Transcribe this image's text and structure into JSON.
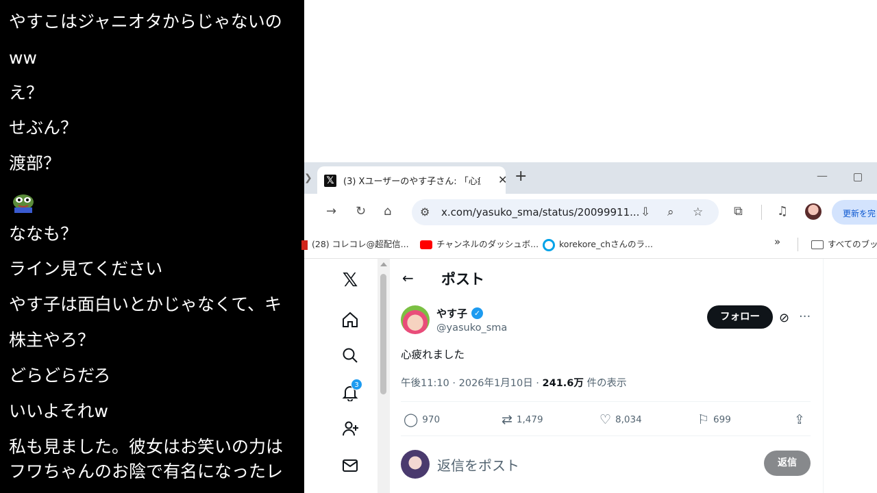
{
  "comments": [
    "やすこはジャニオタからじゃないの",
    "ww",
    "え？",
    "せぶん？",
    "渡部？",
    "ななも？",
    "ライン見てください",
    "やす子は面白いとかじゃなくて、キ",
    "株主やろ？",
    "どらどらだろ",
    "いいよそれw",
    "私も見ました。彼女はお笑いの力は",
    "フワちゃんのお陰で有名になったレ"
  ],
  "browser": {
    "tab_title": "(3) Xユーザーのやす子さん: 「心疲れ",
    "url": "x.com/yasuko_sma/status/20099911...",
    "update_label": "更新を完",
    "bookmarks": [
      "(28) コレコレ@超配信...",
      "チャンネルのダッシュボ...",
      "korekore_chさんのラ...",
      "すべてのブッ"
    ]
  },
  "xpage": {
    "header_title": "ポスト",
    "notification_count": "3",
    "author_name": "やす子",
    "author_handle": "@yasuko_sma",
    "follow_label": "フォロー",
    "post_text": "心疲れました",
    "meta_prefix": "午後11:10 · 2026年1月10日 · ",
    "views": "241.6万",
    "views_suffix": " 件の表示",
    "replies": "970",
    "reposts": "1,479",
    "likes": "8,034",
    "bookmarks": "699",
    "reply_placeholder": "返信をポスト",
    "reply_button": "返信"
  },
  "colors": {
    "x_blue": "#1d9bf0",
    "x_text": "#0f1419",
    "x_muted": "#536471"
  }
}
